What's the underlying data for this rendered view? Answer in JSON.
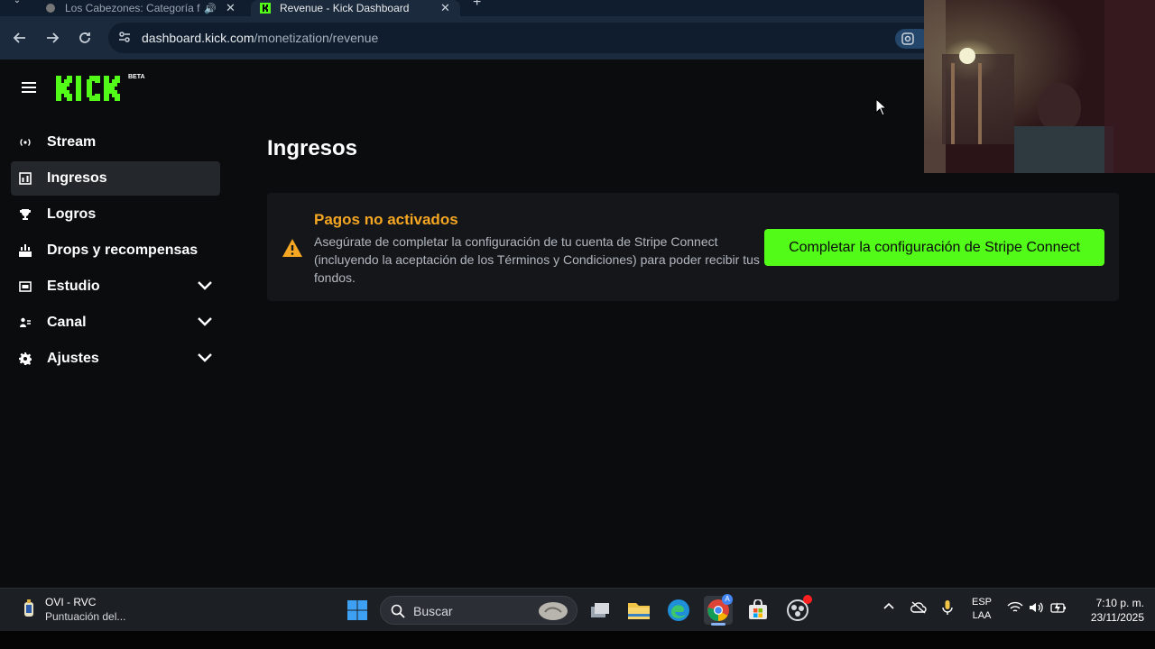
{
  "browser": {
    "tabs": [
      {
        "title": "Los Cabezones: Categoría f",
        "active": false
      },
      {
        "title": "Revenue - Kick Dashboard",
        "active": true
      }
    ],
    "url_domain": "dashboard.kick.com",
    "url_path": "/monetization/revenue"
  },
  "header": {
    "logo_text": "KICK",
    "logo_badge": "BETA"
  },
  "sidebar": {
    "items": [
      {
        "label": "Stream",
        "icon": "broadcast-icon",
        "expandable": false,
        "active": false
      },
      {
        "label": "Ingresos",
        "icon": "bar-chart-icon",
        "expandable": false,
        "active": true
      },
      {
        "label": "Logros",
        "icon": "trophy-icon",
        "expandable": false,
        "active": false
      },
      {
        "label": "Drops y recompensas",
        "icon": "drops-icon",
        "expandable": false,
        "active": false
      },
      {
        "label": "Estudio",
        "icon": "studio-icon",
        "expandable": true,
        "active": false
      },
      {
        "label": "Canal",
        "icon": "channel-icon",
        "expandable": true,
        "active": false
      },
      {
        "label": "Ajustes",
        "icon": "gear-icon",
        "expandable": true,
        "active": false
      }
    ]
  },
  "main": {
    "title": "Ingresos",
    "alert": {
      "title": "Pagos no activados",
      "text": "Asegúrate de completar la configuración de tu cuenta de Stripe Connect (incluyendo la aceptación de los Términos y Condiciones) para poder recibir tus fondos.",
      "button": "Completar la configuración de Stripe Connect"
    }
  },
  "taskbar": {
    "weather_title": "OVI - RVC",
    "weather_sub": "Puntuación del...",
    "search_placeholder": "Buscar",
    "lang_top": "ESP",
    "lang_bottom": "LAA",
    "time": "7:10 p. m.",
    "date": "23/11/2025"
  },
  "colors": {
    "accent": "#53fc18",
    "warning": "#f5a623",
    "background": "#0b0c0e"
  }
}
